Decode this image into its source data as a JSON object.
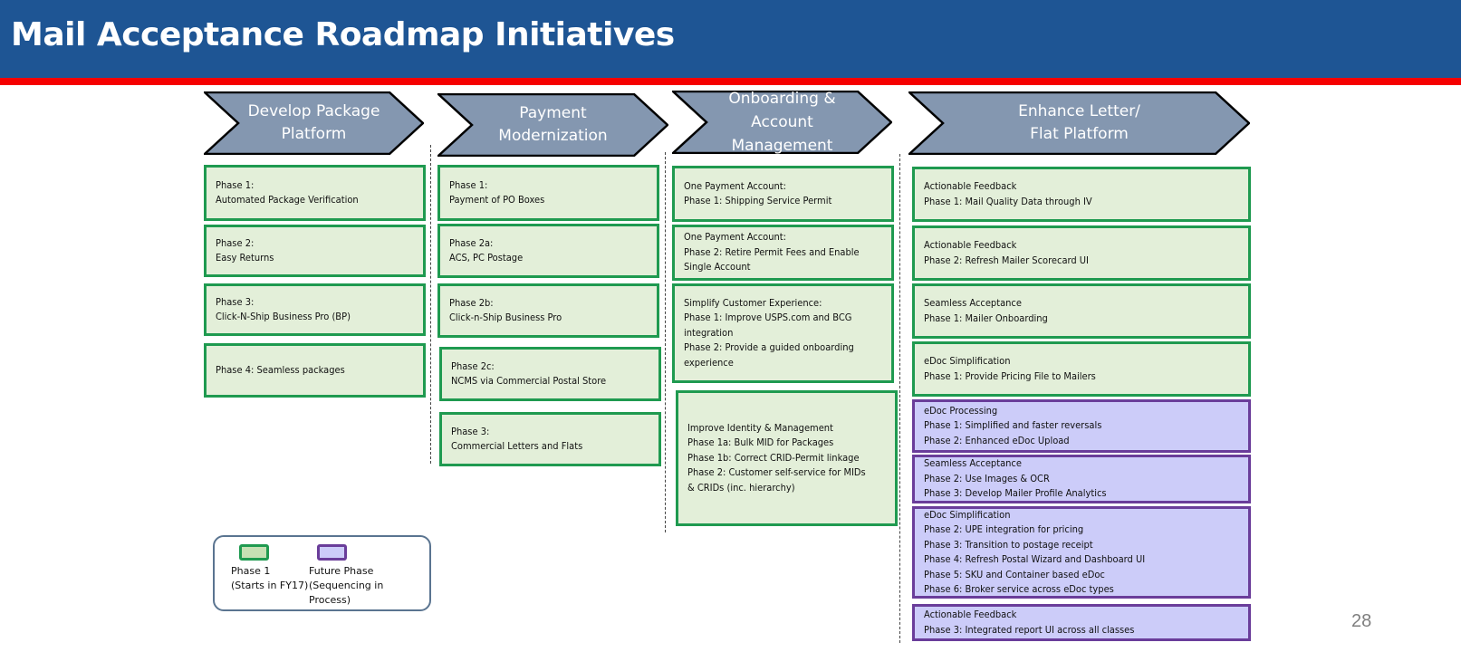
{
  "header": {
    "title": "Mail Acceptance Roadmap Initiatives"
  },
  "columns": [
    {
      "title": "Develop Package\nPlatform",
      "items": [
        {
          "status": "phase1",
          "lines": [
            "Phase 1:",
            "Automated Package Verification"
          ]
        },
        {
          "status": "phase1",
          "lines": [
            "Phase 2:",
            "Easy Returns"
          ]
        },
        {
          "status": "phase1",
          "lines": [
            "Phase 3:",
            " Click-N-Ship Business Pro (BP)"
          ]
        },
        {
          "status": "phase1",
          "lines": [
            "Phase 4: Seamless packages"
          ]
        }
      ]
    },
    {
      "title": "Payment\nModernization",
      "items": [
        {
          "status": "phase1",
          "lines": [
            "Phase 1:",
            "Payment of PO Boxes"
          ]
        },
        {
          "status": "phase1",
          "lines": [
            "Phase 2a:",
            "ACS, PC Postage"
          ]
        },
        {
          "status": "phase1",
          "lines": [
            "Phase 2b:",
            "Click-n-Ship Business Pro"
          ]
        },
        {
          "status": "phase1",
          "lines": [
            "Phase 2c:",
            "NCMS via Commercial Postal Store"
          ]
        },
        {
          "status": "phase1",
          "lines": [
            "Phase 3:",
            "Commercial Letters and Flats"
          ]
        }
      ]
    },
    {
      "title": "Onboarding &\nAccount\nManagement",
      "items": [
        {
          "status": "phase1",
          "lines": [
            "One Payment Account:",
            "Phase 1: Shipping Service Permit"
          ]
        },
        {
          "status": "phase1",
          "lines": [
            "One Payment Account:",
            "Phase 2: Retire Permit Fees and Enable",
            "Single Account"
          ]
        },
        {
          "status": "phase1",
          "lines": [
            "Simplify Customer Experience:",
            "Phase 1: Improve USPS.com and BCG",
            "integration",
            "Phase 2: Provide a guided onboarding",
            "experience"
          ]
        },
        {
          "status": "phase1",
          "lines": [
            "Improve Identity & Management",
            "Phase 1a: Bulk MID for Packages",
            "Phase 1b: Correct CRID-Permit linkage",
            "Phase 2: Customer self-service for MIDs",
            "& CRIDs (inc. hierarchy)"
          ]
        }
      ]
    },
    {
      "title": "Enhance Letter/\nFlat Platform",
      "items": [
        {
          "status": "phase1",
          "lines": [
            "Actionable Feedback",
            "Phase 1: Mail Quality Data through IV"
          ]
        },
        {
          "status": "phase1",
          "lines": [
            "Actionable Feedback",
            "Phase 2: Refresh Mailer Scorecard UI"
          ]
        },
        {
          "status": "phase1",
          "lines": [
            "Seamless Acceptance",
            "Phase 1: Mailer Onboarding"
          ]
        },
        {
          "status": "phase1",
          "lines": [
            "eDoc Simplification",
            "Phase 1: Provide Pricing File to Mailers"
          ]
        },
        {
          "status": "future",
          "lines": [
            "eDoc Processing",
            "Phase 1: Simplified and faster reversals",
            "Phase 2: Enhanced eDoc Upload"
          ]
        },
        {
          "status": "future",
          "lines": [
            "Seamless Acceptance",
            "Phase 2: Use Images & OCR",
            "Phase 3: Develop Mailer Profile Analytics"
          ]
        },
        {
          "status": "future",
          "lines": [
            "eDoc Simplification",
            "Phase 2: UPE integration for pricing",
            "Phase 3: Transition to postage receipt",
            "Phase 4: Refresh Postal Wizard and Dashboard UI",
            "Phase 5: SKU and Container based eDoc",
            "Phase 6: Broker service across eDoc types"
          ]
        },
        {
          "status": "future",
          "lines": [
            "Actionable Feedback",
            "Phase 3: Integrated report UI across all classes"
          ]
        }
      ]
    }
  ],
  "legend": {
    "phase1": {
      "label": "Phase 1\n(Starts in FY17)",
      "color": "#1f9a50",
      "fill": "#c6e0b4"
    },
    "future": {
      "label": "Future Phase\n(Sequencing in\nProcess)",
      "color": "#6a3d9a",
      "fill": "#ccccf9"
    }
  },
  "colors": {
    "header": "#1e5594",
    "accent_bar": "#f50000",
    "chevron_fill": "#8497b0",
    "phase1_border": "#1f9a50",
    "phase1_fill": "#e3efd9",
    "future_border": "#6a3d9a",
    "future_fill": "#ccccf9"
  },
  "page_number": "28"
}
